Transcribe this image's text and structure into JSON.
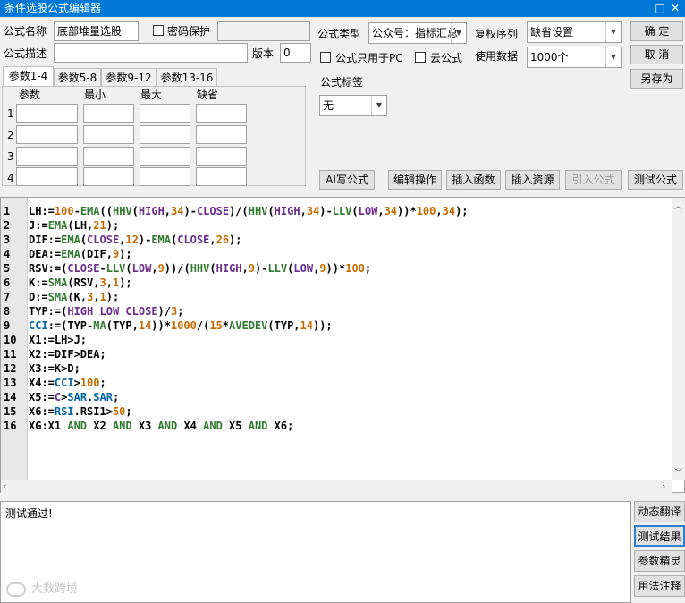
{
  "window": {
    "title": "条件选股公式编辑器",
    "minimize": "□",
    "close": "✕"
  },
  "form": {
    "name_label": "公式名称",
    "name_value": "底部堆量选股",
    "password_label": "密码保护",
    "desc_label": "公式描述",
    "desc_value": "",
    "version_label": "版本",
    "version_value": "0",
    "type_label": "公式类型",
    "type_value": "公众号：指标汇总",
    "rights_label": "复权序列",
    "rights_value": "缺省设置",
    "pc_only_label": "公式只用于PC",
    "cloud_label": "云公式",
    "data_label": "使用数据",
    "data_value": "1000个",
    "tag_label": "公式标签",
    "tag_value": "无"
  },
  "buttons": {
    "ok": "确  定",
    "cancel": "取  消",
    "save_as": "另存为",
    "ai": "AI写公式",
    "edit_ops": "编辑操作",
    "insert_func": "插入函数",
    "insert_res": "插入资源",
    "import_formula": "引入公式",
    "test_formula": "测试公式"
  },
  "params": {
    "tabs": [
      "参数1-4",
      "参数5-8",
      "参数9-12",
      "参数13-16"
    ],
    "headers": [
      "参数",
      "最小",
      "最大",
      "缺省"
    ],
    "rows": [
      "1",
      "2",
      "3",
      "4"
    ]
  },
  "editor": {
    "line_numbers": [
      "1",
      "2",
      "3",
      "4",
      "5",
      "6",
      "7",
      "8",
      "9",
      "10",
      "11",
      "12",
      "13",
      "14",
      "15",
      "16"
    ]
  },
  "output": {
    "text": "测试通过!",
    "watermark": "大数跨境"
  },
  "side_buttons": [
    "动态翻译",
    "测试结果",
    "参数精灵",
    "用法注释"
  ]
}
